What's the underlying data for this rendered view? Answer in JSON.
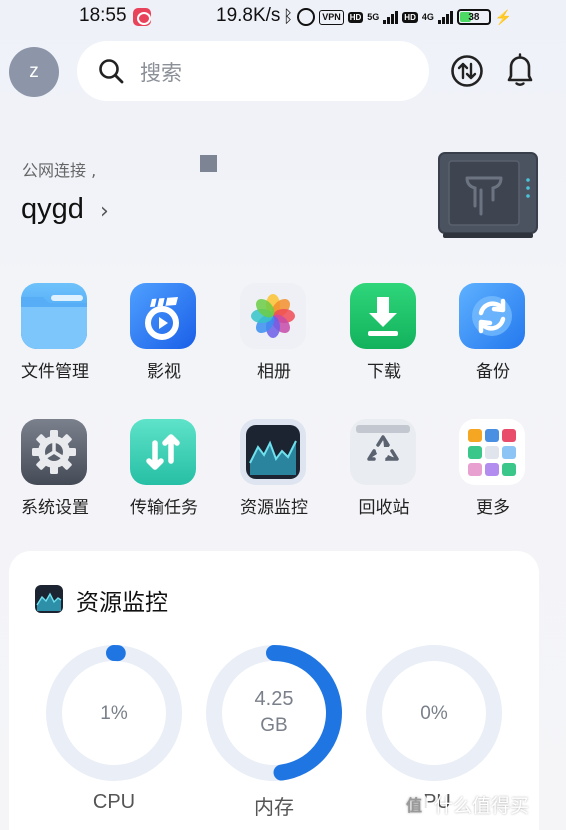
{
  "status_bar": {
    "time": "18:55",
    "net_speed": "19.8K/s",
    "vpn": "VPN",
    "hd1": "HD",
    "net1": "5G",
    "hd2": "HD",
    "net2": "4G",
    "battery": "38"
  },
  "header": {
    "avatar_letter": "z",
    "search_placeholder": "搜索"
  },
  "device": {
    "network_status": "公网连接 ,",
    "name": "qygd",
    "chevron": "›"
  },
  "apps": [
    {
      "label": "文件管理",
      "icon": "folder-icon",
      "color": "#4aa6f3"
    },
    {
      "label": "影视",
      "icon": "video-icon",
      "color": "#2e7cf6"
    },
    {
      "label": "相册",
      "icon": "photos-icon",
      "color": "#f2f3f7"
    },
    {
      "label": "下载",
      "icon": "download-icon",
      "color": "#1fc26b"
    },
    {
      "label": "备份",
      "icon": "backup-icon",
      "color": "#3d93f5"
    },
    {
      "label": "系统设置",
      "icon": "settings-icon",
      "color": "#5b626e"
    },
    {
      "label": "传输任务",
      "icon": "transfer-tasks-icon",
      "color": "#3fd2b9"
    },
    {
      "label": "资源监控",
      "icon": "monitor-icon",
      "color": "#1d2533"
    },
    {
      "label": "回收站",
      "icon": "recycle-bin-icon",
      "color": "#e6e9ee"
    },
    {
      "label": "更多",
      "icon": "more-apps-icon",
      "color": "#ffffff"
    }
  ],
  "monitor": {
    "title": "资源监控",
    "accent": "#1f76e3",
    "track": "#e9eef7",
    "gauges": [
      {
        "label": "CPU",
        "value": "1%",
        "fraction": 0.01
      },
      {
        "label": "内存",
        "value_line1": "4.25",
        "value_line2": "GB",
        "fraction": 0.48
      },
      {
        "label": "PU",
        "value": "0%",
        "fraction": 0.0
      }
    ]
  },
  "watermark": "什么值得买"
}
